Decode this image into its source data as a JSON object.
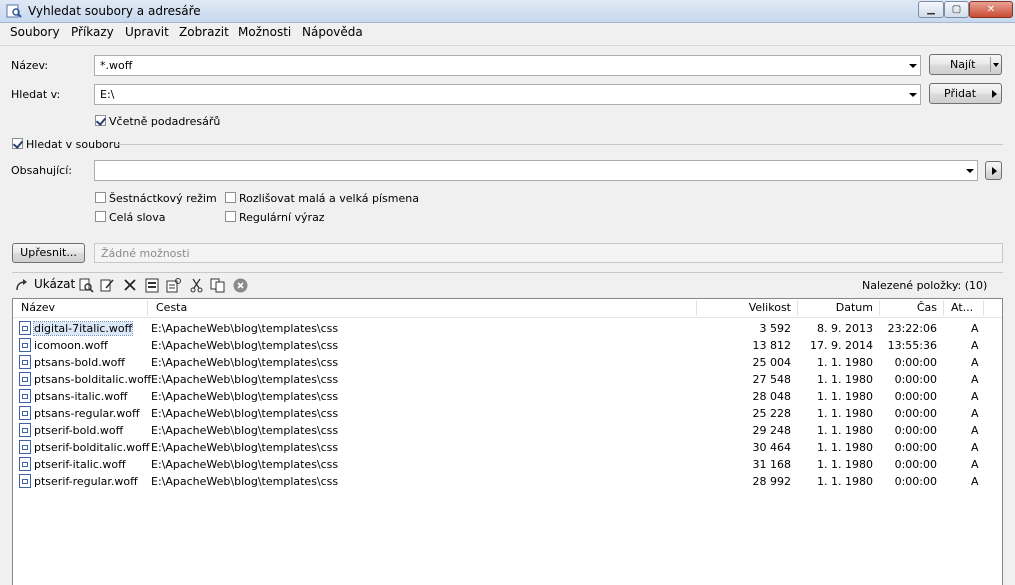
{
  "window": {
    "title": "Vyhledat soubory a adresáře"
  },
  "menu": [
    "Soubory",
    "Příkazy",
    "Upravit",
    "Zobrazit",
    "Možnosti",
    "Nápověda"
  ],
  "form": {
    "name_label": "Název:",
    "name_value": "*.woff",
    "search_in_label": "Hledat v:",
    "search_in_value": "E:\\",
    "subfolders_label": "Včetně podadresářů",
    "subfolders_checked": true,
    "search_in_file_label": "Hledat v souboru",
    "search_in_file_checked": true,
    "containing_label": "Obsahující:",
    "containing_value": "",
    "hex_label": "Šestnáctkový režim",
    "whole_words_label": "Celá slova",
    "case_label": "Rozlišovat malá a velká písmena",
    "regex_label": "Regulární výraz",
    "refine_label": "Upřesnit...",
    "no_options_text": "Žádné možnosti"
  },
  "buttons": {
    "find": "Najít",
    "add": "Přidat"
  },
  "toolbar": {
    "show_label": "Ukázat",
    "found_text": "Nalezené položky: (10)",
    "icons": [
      "view-icon",
      "edit-icon",
      "delete-icon",
      "archive-icon",
      "properties-icon",
      "cut-icon",
      "copy-icon",
      "clear-icon"
    ]
  },
  "results": {
    "columns": [
      "Název",
      "Cesta",
      "Velikost",
      "Datum",
      "Čas",
      "At..."
    ],
    "rows": [
      {
        "name": "digital-7italic.woff",
        "path": "E:\\ApacheWeb\\blog\\templates\\css",
        "size": "3 592",
        "date": "8. 9. 2013",
        "time": "23:22:06",
        "attr": "A"
      },
      {
        "name": "icomoon.woff",
        "path": "E:\\ApacheWeb\\blog\\templates\\css",
        "size": "13 812",
        "date": "17. 9. 2014",
        "time": "13:55:36",
        "attr": "A"
      },
      {
        "name": "ptsans-bold.woff",
        "path": "E:\\ApacheWeb\\blog\\templates\\css",
        "size": "25 004",
        "date": "1. 1. 1980",
        "time": "0:00:00",
        "attr": "A"
      },
      {
        "name": "ptsans-bolditalic.woff",
        "path": "E:\\ApacheWeb\\blog\\templates\\css",
        "size": "27 548",
        "date": "1. 1. 1980",
        "time": "0:00:00",
        "attr": "A"
      },
      {
        "name": "ptsans-italic.woff",
        "path": "E:\\ApacheWeb\\blog\\templates\\css",
        "size": "28 048",
        "date": "1. 1. 1980",
        "time": "0:00:00",
        "attr": "A"
      },
      {
        "name": "ptsans-regular.woff",
        "path": "E:\\ApacheWeb\\blog\\templates\\css",
        "size": "25 228",
        "date": "1. 1. 1980",
        "time": "0:00:00",
        "attr": "A"
      },
      {
        "name": "ptserif-bold.woff",
        "path": "E:\\ApacheWeb\\blog\\templates\\css",
        "size": "29 248",
        "date": "1. 1. 1980",
        "time": "0:00:00",
        "attr": "A"
      },
      {
        "name": "ptserif-bolditalic.woff",
        "path": "E:\\ApacheWeb\\blog\\templates\\css",
        "size": "30 464",
        "date": "1. 1. 1980",
        "time": "0:00:00",
        "attr": "A"
      },
      {
        "name": "ptserif-italic.woff",
        "path": "E:\\ApacheWeb\\blog\\templates\\css",
        "size": "31 168",
        "date": "1. 1. 1980",
        "time": "0:00:00",
        "attr": "A"
      },
      {
        "name": "ptserif-regular.woff",
        "path": "E:\\ApacheWeb\\blog\\templates\\css",
        "size": "28 992",
        "date": "1. 1. 1980",
        "time": "0:00:00",
        "attr": "A"
      }
    ]
  }
}
